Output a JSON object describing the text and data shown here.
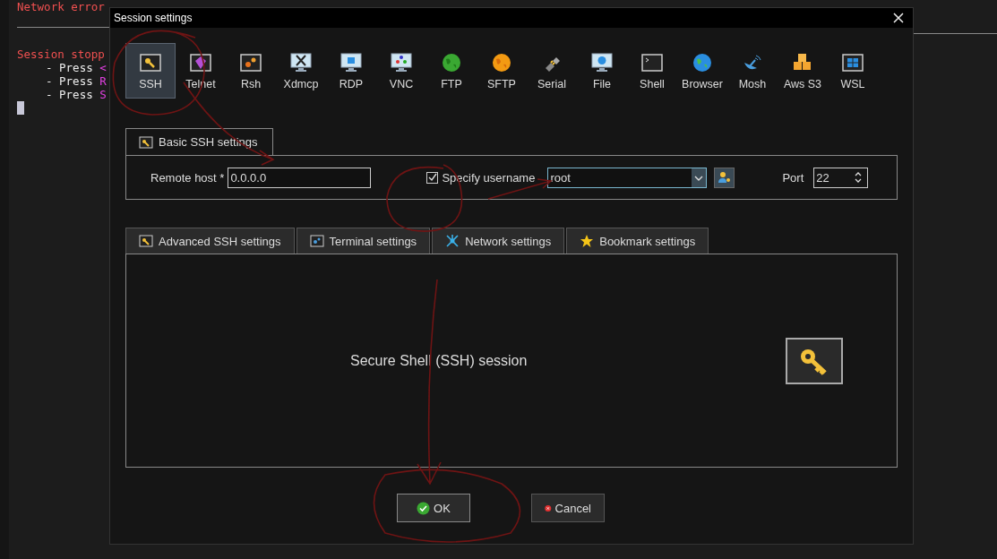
{
  "terminal": {
    "error": "Network error",
    "stopped": "Session stopp",
    "hints": [
      {
        "text": "- Press ",
        "key": "<"
      },
      {
        "text": "- Press ",
        "key": "R"
      },
      {
        "text": "- Press ",
        "key": "S"
      }
    ]
  },
  "dialog": {
    "title": "Session settings"
  },
  "protocols": [
    {
      "label": "SSH",
      "selected": true
    },
    {
      "label": "Telnet",
      "selected": false
    },
    {
      "label": "Rsh",
      "selected": false
    },
    {
      "label": "Xdmcp",
      "selected": false
    },
    {
      "label": "RDP",
      "selected": false
    },
    {
      "label": "VNC",
      "selected": false
    },
    {
      "label": "FTP",
      "selected": false
    },
    {
      "label": "SFTP",
      "selected": false
    },
    {
      "label": "Serial",
      "selected": false
    },
    {
      "label": "File",
      "selected": false
    },
    {
      "label": "Shell",
      "selected": false
    },
    {
      "label": "Browser",
      "selected": false
    },
    {
      "label": "Mosh",
      "selected": false
    },
    {
      "label": "Aws S3",
      "selected": false
    },
    {
      "label": "WSL",
      "selected": false
    }
  ],
  "basic_tab": {
    "label": "Basic SSH settings",
    "selected": true
  },
  "remote_host": {
    "label": "Remote host *",
    "value": "0.0.0.0"
  },
  "specify_username": {
    "label": "Specify username",
    "checked": true
  },
  "username": {
    "value": "root"
  },
  "port": {
    "label": "Port",
    "value": "22"
  },
  "tabs": [
    {
      "label": "Advanced SSH settings",
      "selected": false
    },
    {
      "label": "Terminal settings",
      "selected": false
    },
    {
      "label": "Network settings",
      "selected": false
    },
    {
      "label": "Bookmark settings",
      "selected": false
    }
  ],
  "panel": {
    "text": "Secure Shell (SSH) session"
  },
  "buttons": [
    {
      "label": "OK",
      "kind": "ok"
    },
    {
      "label": "Cancel",
      "kind": "cancel"
    }
  ]
}
